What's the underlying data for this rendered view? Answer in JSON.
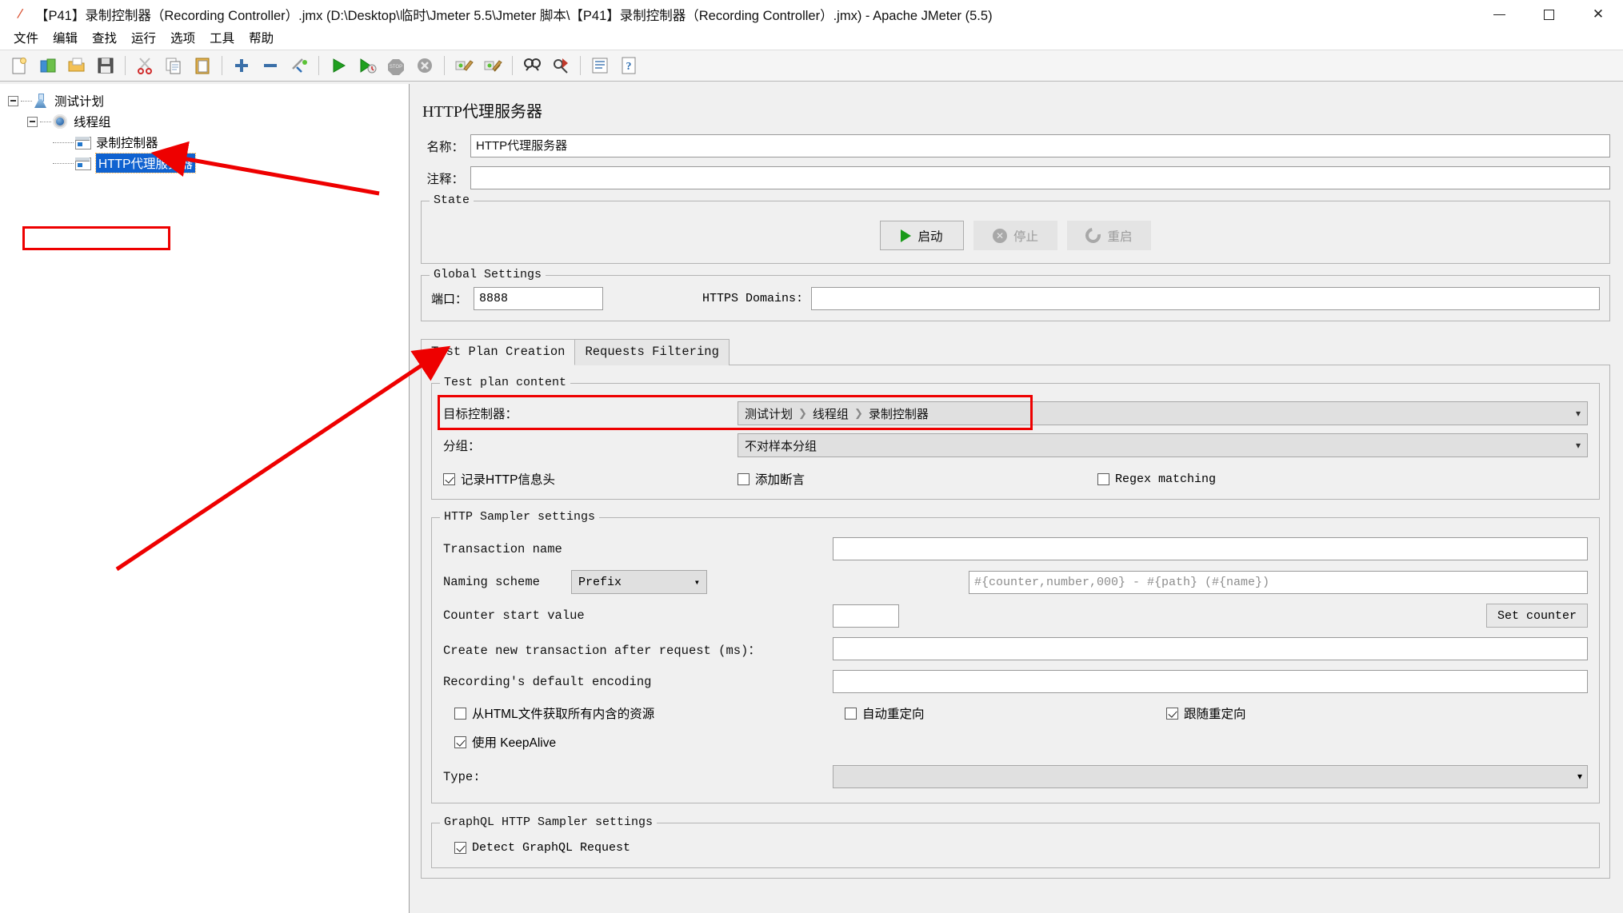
{
  "window": {
    "title": "【P41】录制控制器（Recording Controller）.jmx (D:\\Desktop\\临时\\Jmeter 5.5\\Jmeter 脚本\\【P41】录制控制器（Recording Controller）.jmx) - Apache JMeter (5.5)",
    "app_icon": "jmeter-feather-icon",
    "minimize": "minimize-button",
    "maximize": "maximize-button",
    "close_label": "✕"
  },
  "menubar": {
    "items": [
      {
        "label": "文件",
        "name": "menu-file"
      },
      {
        "label": "编辑",
        "name": "menu-edit"
      },
      {
        "label": "查找",
        "name": "menu-search"
      },
      {
        "label": "运行",
        "name": "menu-run"
      },
      {
        "label": "选项",
        "name": "menu-options"
      },
      {
        "label": "工具",
        "name": "menu-tools"
      },
      {
        "label": "帮助",
        "name": "menu-help"
      }
    ]
  },
  "toolbar": {
    "items": [
      {
        "name": "new-icon"
      },
      {
        "name": "templates-icon"
      },
      {
        "name": "open-icon"
      },
      {
        "name": "save-icon"
      },
      {
        "name": "cut-icon"
      },
      {
        "name": "copy-icon"
      },
      {
        "name": "paste-icon"
      },
      {
        "name": "expand-all-icon"
      },
      {
        "name": "collapse-all-icon"
      },
      {
        "name": "toggle-icon"
      },
      {
        "name": "start-icon"
      },
      {
        "name": "start-no-pauses-icon"
      },
      {
        "name": "stop-icon"
      },
      {
        "name": "shutdown-icon"
      },
      {
        "name": "clear-icon"
      },
      {
        "name": "clear-all-icon"
      },
      {
        "name": "search-icon"
      },
      {
        "name": "search-reset-icon"
      },
      {
        "name": "function-helper-icon"
      },
      {
        "name": "help-icon"
      }
    ]
  },
  "tree": {
    "nodes": [
      {
        "label": "测试计划",
        "icon": "test-plan-icon",
        "depth": 0,
        "expandable": true,
        "selected": false
      },
      {
        "label": "线程组",
        "icon": "thread-group-icon",
        "depth": 1,
        "expandable": true,
        "selected": false
      },
      {
        "label": "录制控制器",
        "icon": "recording-controller-icon",
        "depth": 2,
        "expandable": false,
        "selected": false
      },
      {
        "label": "HTTP代理服务器",
        "icon": "http-proxy-icon",
        "depth": 2,
        "expandable": false,
        "selected": true
      }
    ]
  },
  "panel": {
    "title": "HTTP代理服务器",
    "name_label": "名称：",
    "name_value": "HTTP代理服务器",
    "comment_label": "注释：",
    "comment_value": ""
  },
  "state": {
    "group_title": "State",
    "start_label": "启动",
    "stop_label": "停止",
    "restart_label": "重启"
  },
  "global_settings": {
    "group_title": "Global Settings",
    "port_label": "端口：",
    "port_value": "8888",
    "https_domains_label": "HTTPS Domains:",
    "https_domains_value": ""
  },
  "tabs": [
    {
      "label": "Test Plan Creation",
      "name": "tab-test-plan-creation",
      "active": true
    },
    {
      "label": "Requests Filtering",
      "name": "tab-requests-filtering",
      "active": false
    }
  ],
  "test_plan_content": {
    "group_title": "Test plan content",
    "target_controller_label": "目标控制器：",
    "target_controller_path": [
      "测试计划",
      "线程组",
      "录制控制器"
    ],
    "grouping_label": "分组：",
    "grouping_value": "不对样本分组",
    "checkboxes": [
      {
        "label": "记录HTTP信息头",
        "checked": true,
        "name": "capture-http-headers-checkbox"
      },
      {
        "label": "添加断言",
        "checked": false,
        "name": "add-assertions-checkbox"
      },
      {
        "label": "Regex matching",
        "checked": false,
        "name": "regex-matching-checkbox"
      }
    ]
  },
  "http_sampler_settings": {
    "group_title": "HTTP Sampler settings",
    "transaction_name_label": "Transaction name",
    "transaction_name_value": "",
    "naming_scheme_label": "Naming scheme",
    "naming_scheme_value": "Prefix",
    "naming_pattern_placeholder": "#{counter,number,000} - #{path} (#{name})",
    "counter_start_label": "Counter start value",
    "counter_start_value": "",
    "set_counter_label": "Set counter",
    "create_new_transaction_label": "Create new transaction after request (ms)：",
    "create_new_transaction_value": "",
    "default_encoding_label": "Recording's default encoding",
    "default_encoding_value": "",
    "checkboxes": [
      {
        "label": "从HTML文件获取所有内含的资源",
        "checked": false,
        "name": "retrieve-embedded-resources-checkbox"
      },
      {
        "label": "自动重定向",
        "checked": false,
        "name": "redirect-automatically-checkbox"
      },
      {
        "label": "跟随重定向",
        "checked": true,
        "name": "follow-redirects-checkbox"
      },
      {
        "label": "使用 KeepAlive",
        "checked": true,
        "name": "use-keepalive-checkbox"
      }
    ],
    "type_label": "Type:",
    "type_value": ""
  },
  "graphql_settings": {
    "group_title": "GraphQL HTTP Sampler settings",
    "detect_label": "Detect GraphQL Request",
    "detect_checked": true
  },
  "annotations": {
    "highlight_color": "#ee0000",
    "arrow_count": 2
  }
}
